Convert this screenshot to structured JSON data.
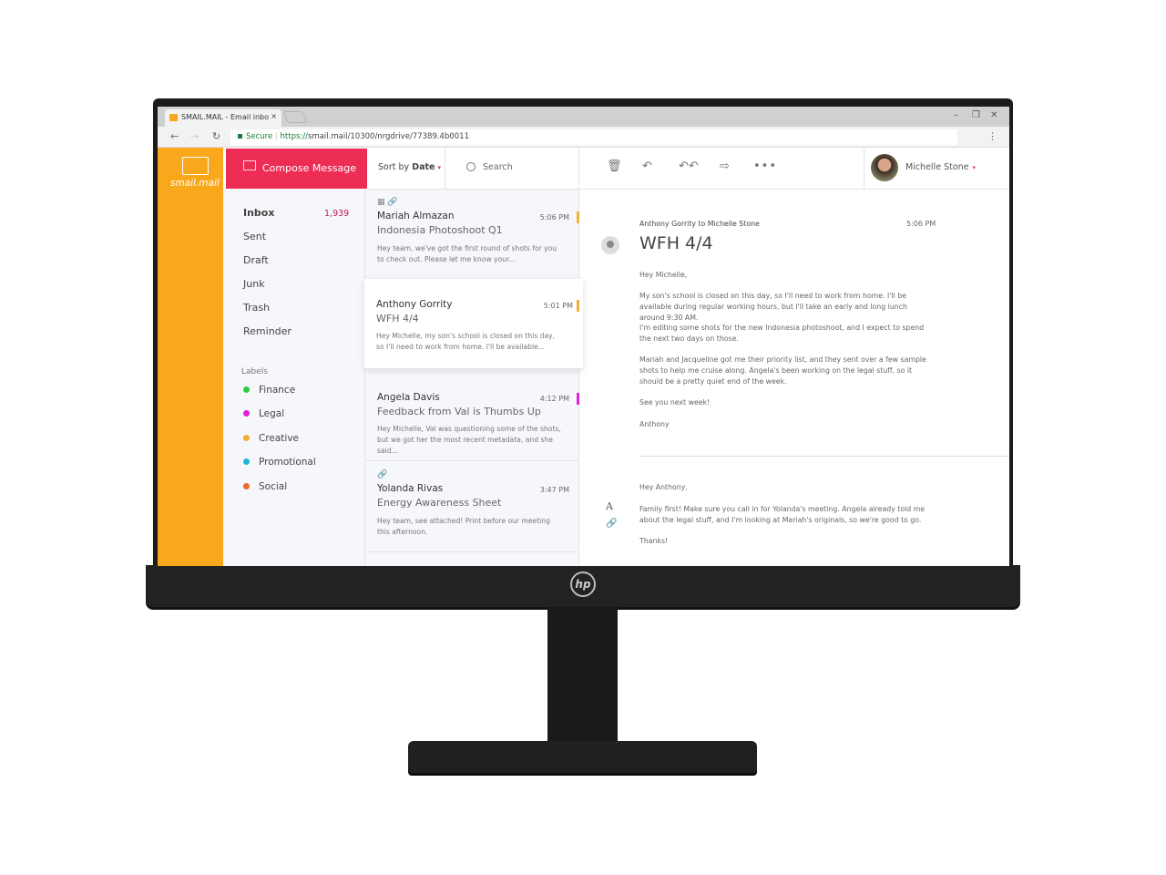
{
  "browser": {
    "tab_title": "SMAIL.MAIL - Email inbo",
    "secure_label": "Secure",
    "url_scheme": "https://",
    "url_rest": "smail.mail/10300/nrgdrive/77389.4b0011"
  },
  "brand": {
    "name": "smail.mail",
    "color": "#f9a81b"
  },
  "compose": {
    "label": "Compose Message",
    "color": "#ee2d55"
  },
  "nav": {
    "items": [
      {
        "label": "Inbox",
        "count": "1,939"
      },
      {
        "label": "Sent"
      },
      {
        "label": "Draft"
      },
      {
        "label": "Junk"
      },
      {
        "label": "Trash"
      },
      {
        "label": "Reminder"
      }
    ]
  },
  "labels": {
    "heading": "Labels",
    "items": [
      {
        "label": "Finance",
        "color": "#2ecc40"
      },
      {
        "label": "Legal",
        "color": "#e020d8"
      },
      {
        "label": "Creative",
        "color": "#f0b030"
      },
      {
        "label": "Promotional",
        "color": "#1fb5d6"
      },
      {
        "label": "Social",
        "color": "#ee6a2c"
      }
    ]
  },
  "list_header": {
    "sort_prefix": "Sort by",
    "sort_value": "Date",
    "search_placeholder": "Search"
  },
  "toolbar": {
    "icons": [
      "trash-icon",
      "reply-icon",
      "reply-all-icon",
      "forward-icon",
      "more-icon"
    ]
  },
  "user": {
    "name": "Michelle Stone"
  },
  "messages": [
    {
      "from": "Mariah Almazan",
      "subject": "Indonesia Photoshoot Q1",
      "time": "5:06 PM",
      "preview": "Hey team, we've got the first round of shots for you to check out. Please let me know your...",
      "flag": "#f0b030",
      "icons": "▦ 🔗"
    },
    {
      "from": "Anthony Gorrity",
      "subject": "WFH 4/4",
      "time": "5:01 PM",
      "preview": "Hey Michelle, my son's school is closed on this day, so I'll need to work from home. I'll be available...",
      "flag": "#f0b030",
      "selected": true
    },
    {
      "from": "Angela Davis",
      "subject": "Feedback from Val is Thumbs Up",
      "time": "4:12 PM",
      "preview": "Hey Michelle, Val was questioning some of the shots, but we got her the most recent metadata, and she said...",
      "flag": "#e020d8"
    },
    {
      "from": "Yolanda Rivas",
      "subject": "Energy Awareness Sheet",
      "time": "3:47 PM",
      "preview": "Hey team, see attached! Print before our meeting this afternoon.",
      "icons": "🔗"
    }
  ],
  "reading": {
    "meta": "Anthony Gorrity to Michelle Stone",
    "time": "5:06 PM",
    "subject": "WFH 4/4",
    "body": [
      "Hey Michelle,",
      "My son's school is closed on this day, so I'll need to work from home. I'll be available during regular working hours, but I'll take an early and long lunch around 9:30 AM.",
      "I'm editing some shots for the new Indonesia photoshoot, and I expect to spend the next two days on those.",
      "Mariah and Jacqueline got me their priority list, and they sent over a few sample shots to help me cruise along. Angela's been working on the legal stuff, so it should be a pretty quiet end of the week.",
      "See you next week!",
      "Anthony"
    ],
    "reply": [
      "Hey Anthony,",
      "Family first! Make sure you call in for Yolanda's meeting. Angela already told me about the legal stuff, and I'm looking at Mariah's originals, so we're good to go.",
      "Thanks!"
    ],
    "format_icon_label": "A"
  },
  "monitor": {
    "logo": "hp"
  }
}
